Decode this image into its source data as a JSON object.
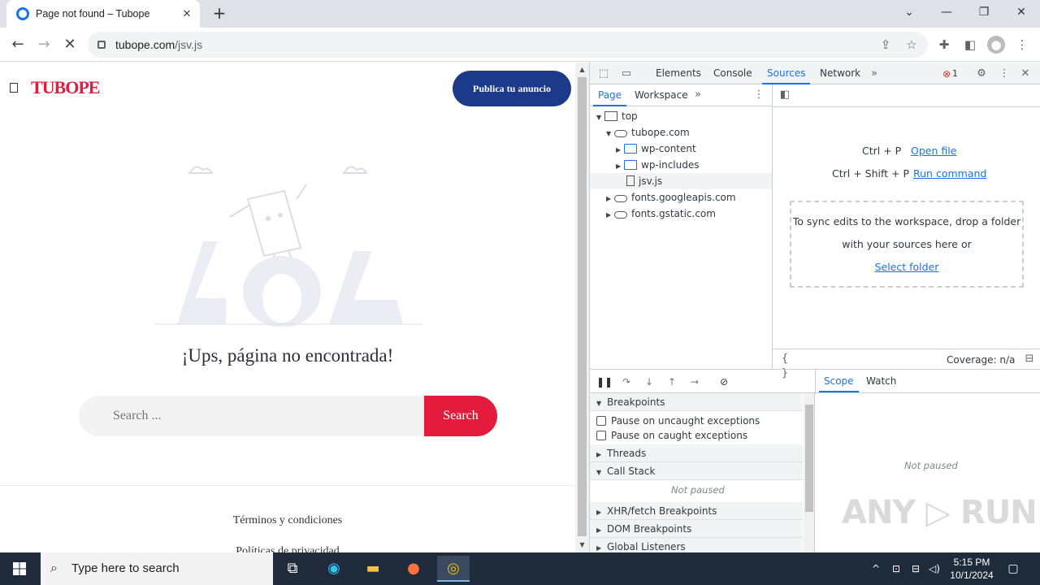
{
  "browser": {
    "tab_title": "Page not found – Tubope",
    "url_domain": "tubope.com",
    "url_path": "/jsv.js"
  },
  "page": {
    "logo_text": "TUBOPE",
    "publish_button": "Publica tu anuncio",
    "error_title": "¡Ups, página no encontrada!",
    "search_placeholder": "Search ...",
    "search_button": "Search",
    "footer_links": [
      "Términos y condiciones",
      "Políticas de privacidad"
    ]
  },
  "devtools": {
    "tabs": [
      "Elements",
      "Console",
      "Sources",
      "Network"
    ],
    "active_tab": "Sources",
    "error_count": "1",
    "subtabs": [
      "Page",
      "Workspace"
    ],
    "tree": [
      {
        "label": "top",
        "level": 0,
        "icon": "frame",
        "expanded": true
      },
      {
        "label": "tubope.com",
        "level": 1,
        "icon": "cloud",
        "expanded": true
      },
      {
        "label": "wp-content",
        "level": 2,
        "icon": "folder",
        "expanded": false
      },
      {
        "label": "wp-includes",
        "level": 2,
        "icon": "folder",
        "expanded": false
      },
      {
        "label": "jsv.js",
        "level": 2,
        "icon": "file",
        "selected": true
      },
      {
        "label": "fonts.googleapis.com",
        "level": 1,
        "icon": "cloud",
        "expanded": false
      },
      {
        "label": "fonts.gstatic.com",
        "level": 1,
        "icon": "cloud",
        "expanded": false
      }
    ],
    "shortcuts": [
      {
        "keys": "Ctrl + P",
        "action": "Open file"
      },
      {
        "keys": "Ctrl + Shift + P",
        "action": "Run command"
      }
    ],
    "dropzone_text": "To sync edits to the workspace, drop a folder with your sources here or",
    "dropzone_link": "Select folder",
    "coverage": "Coverage: n/a",
    "sections": {
      "breakpoints": "Breakpoints",
      "pause_uncaught": "Pause on uncaught exceptions",
      "pause_caught": "Pause on caught exceptions",
      "threads": "Threads",
      "call_stack": "Call Stack",
      "not_paused": "Not paused",
      "xhr": "XHR/fetch Breakpoints",
      "dom": "DOM Breakpoints",
      "global": "Global Listeners"
    },
    "right_tabs": [
      "Scope",
      "Watch"
    ],
    "right_not_paused": "Not paused"
  },
  "taskbar": {
    "search_placeholder": "Type here to search",
    "time": "5:15 PM",
    "date": "10/1/2024"
  },
  "watermark": "ANY RUN",
  "colors": {
    "brand_red": "#e41b3d",
    "publish_blue": "#1d3a8a",
    "devtools_accent": "#1a73e8"
  }
}
